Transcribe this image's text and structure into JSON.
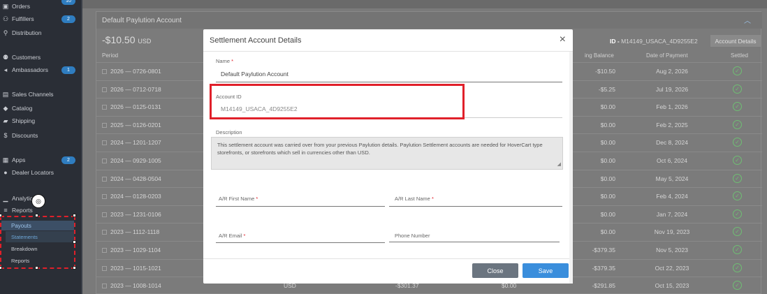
{
  "sidebar": {
    "items": [
      {
        "label": "Orders",
        "icon": "box-icon",
        "badge": "10"
      },
      {
        "label": "Fulfillers",
        "icon": "users-icon",
        "badge": "2"
      },
      {
        "label": "Distribution",
        "icon": "network-icon",
        "badge": ""
      },
      {
        "label": "Customers",
        "icon": "people-icon",
        "badge": ""
      },
      {
        "label": "Ambassadors",
        "icon": "megaphone-icon",
        "badge": "1"
      },
      {
        "label": "Sales Channels",
        "icon": "store-icon",
        "badge": ""
      },
      {
        "label": "Catalog",
        "icon": "tag-icon",
        "badge": ""
      },
      {
        "label": "Shipping",
        "icon": "truck-icon",
        "badge": ""
      },
      {
        "label": "Discounts",
        "icon": "dollar-icon",
        "badge": ""
      },
      {
        "label": "Apps",
        "icon": "grid-icon",
        "badge": "2"
      },
      {
        "label": "Dealer Locators",
        "icon": "pin-icon",
        "badge": ""
      },
      {
        "label": "Analytics",
        "icon": "chart-icon",
        "badge": ""
      },
      {
        "label": "Reports",
        "icon": "database-icon",
        "badge": ""
      }
    ],
    "payouts": {
      "label": "Payouts",
      "subitems": [
        "Statements",
        "Breakdown",
        "Reports"
      ],
      "active_sub": "Statements"
    }
  },
  "account": {
    "title": "Default Paylution Account",
    "balance": "-$10.50",
    "currency": "USD",
    "id_label": "ID -",
    "id_value": "M14149_USACA_4D9255E2",
    "details_button": "Account Details"
  },
  "table": {
    "headers": {
      "period": "Period",
      "closing": "ing Balance",
      "date": "Date of Payment",
      "settled": "Settled"
    },
    "rows": [
      {
        "period": "2026 — 0726-0801",
        "currency": "",
        "debit": "",
        "credit": "",
        "balance": "-$10.50",
        "date": "Aug 2, 2026"
      },
      {
        "period": "2026 — 0712-0718",
        "currency": "",
        "debit": "",
        "credit": "",
        "balance": "-$5.25",
        "date": "Jul 19, 2026"
      },
      {
        "period": "2026 — 0125-0131",
        "currency": "",
        "debit": "",
        "credit": "",
        "balance": "$0.00",
        "date": "Feb 1, 2026"
      },
      {
        "period": "2025 — 0126-0201",
        "currency": "",
        "debit": "",
        "credit": "",
        "balance": "$0.00",
        "date": "Feb 2, 2025"
      },
      {
        "period": "2024 — 1201-1207",
        "currency": "",
        "debit": "",
        "credit": "",
        "balance": "$0.00",
        "date": "Dec 8, 2024"
      },
      {
        "period": "2024 — 0929-1005",
        "currency": "",
        "debit": "",
        "credit": "",
        "balance": "$0.00",
        "date": "Oct 6, 2024"
      },
      {
        "period": "2024 — 0428-0504",
        "currency": "",
        "debit": "",
        "credit": "",
        "balance": "$0.00",
        "date": "May 5, 2024"
      },
      {
        "period": "2024 — 0128-0203",
        "currency": "",
        "debit": "",
        "credit": "",
        "balance": "$0.00",
        "date": "Feb 4, 2024"
      },
      {
        "period": "2023 — 1231-0106",
        "currency": "",
        "debit": "",
        "credit": "",
        "balance": "$0.00",
        "date": "Jan 7, 2024"
      },
      {
        "period": "2023 — 1112-1118",
        "currency": "",
        "debit": "",
        "credit": "",
        "balance": "$0.00",
        "date": "Nov 19, 2023"
      },
      {
        "period": "2023 — 1029-1104",
        "currency": "",
        "debit": "",
        "credit": "",
        "balance": "-$379.35",
        "date": "Nov 5, 2023"
      },
      {
        "period": "2023 — 1015-1021",
        "currency": "",
        "debit": "",
        "credit": "",
        "balance": "-$379.35",
        "date": "Oct 22, 2023"
      },
      {
        "period": "2023 — 1008-1014",
        "currency": "USD",
        "debit": "-$301.37",
        "credit": "$0.00",
        "balance": "-$291.85",
        "date": "Oct 15, 2023"
      }
    ]
  },
  "modal": {
    "title": "Settlement Account Details",
    "close_icon": "×",
    "name_label": "Name",
    "name_value": "Default Paylution Account",
    "account_id_label": "Account ID",
    "account_id_value": "M14149_USACA_4D9255E2",
    "description_label": "Description",
    "description_value": "This settlement account was carried over from your previous Paylution details. Paylution Settlement accounts are needed for HoverCart type storefronts, or storefronts which sell in currencies other than USD.",
    "ar_first_label": "A/R First Name",
    "ar_last_label": "A/R Last Name",
    "ar_email_label": "A/R Email",
    "phone_label": "Phone Number",
    "required_mark": "*",
    "close_button": "Close",
    "save_button": "Save"
  }
}
